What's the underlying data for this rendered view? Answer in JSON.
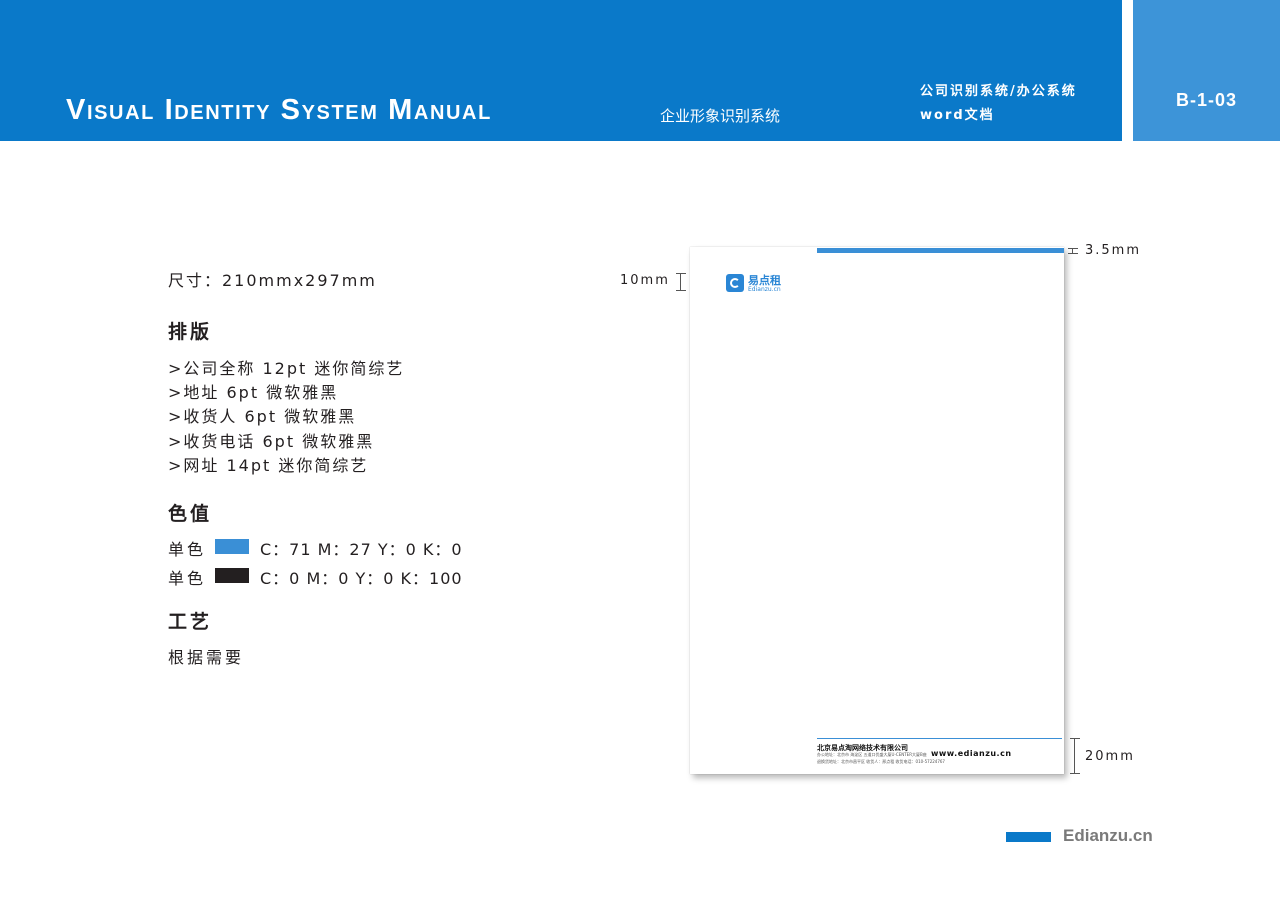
{
  "header": {
    "title": "Visual Identity System Manual",
    "subtitle": "企业形象识别系统",
    "category_line1": "公司识别系统/办公系统",
    "category_line2": "word文档",
    "page_code": "B-1-03",
    "color": "#0a79c9"
  },
  "spec": {
    "size": "尺寸：210mmx297mm",
    "layout_heading": "排版",
    "layout_items": [
      ">公司全称  12pt  迷你简综艺",
      ">地址  6pt  微软雅黑",
      ">收货人  6pt  微软雅黑",
      ">收货电话  6pt  微软雅黑",
      ">网址  14pt  迷你简综艺"
    ],
    "color_heading": "色值",
    "colors": [
      {
        "label": "单色",
        "value": "C：71 M：27 Y：0 K：0",
        "swatch": "#3a8fd6"
      },
      {
        "label": "单色",
        "value": "C：0 M：0 Y：0 K：100",
        "swatch": "#231f20"
      }
    ],
    "process_heading": "工艺",
    "process_text": "根据需要"
  },
  "mockup": {
    "logo_cn": "易点租",
    "logo_en": "Edianzu.cn",
    "company": "北京易点淘网络技术有限公司",
    "website": "www.edianzu.cn",
    "address_line1": "办公地址：北京市 海淀区 五道口优盛大厦U-CENTER大厦B座",
    "address_line2": "退换货地址：北京市昌平区 收货人：邢点租  收货电话：010-57224767",
    "dim_top": "3.5mm",
    "dim_margin": "10mm",
    "dim_footer": "20mm"
  },
  "footer": {
    "brand": "Edianzu.cn"
  }
}
